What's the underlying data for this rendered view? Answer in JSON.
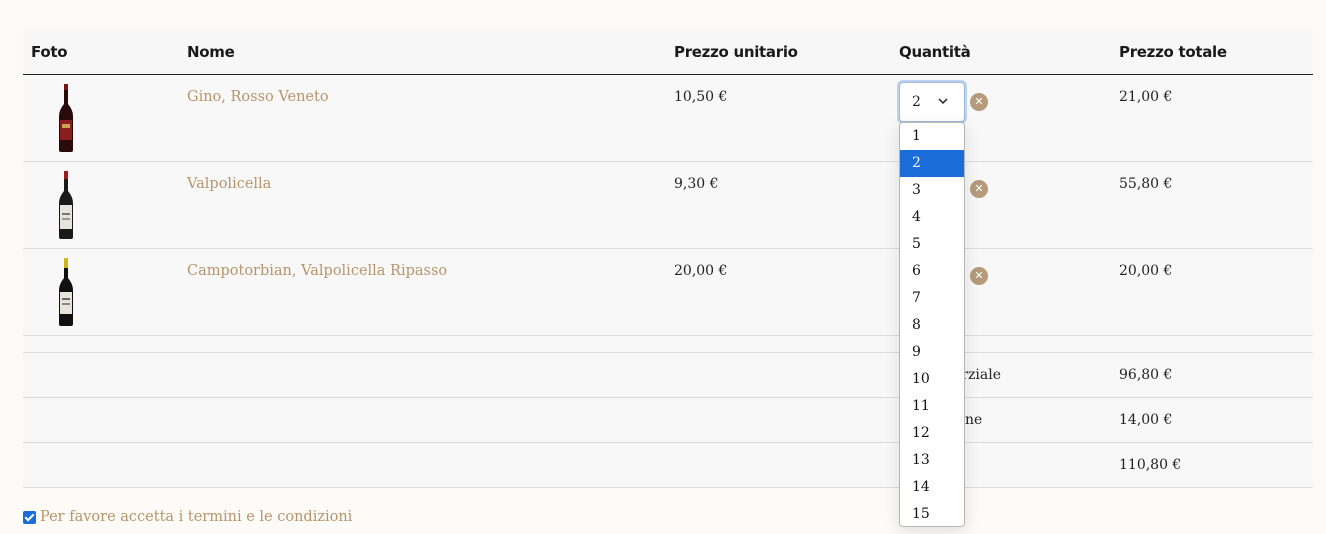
{
  "table": {
    "headers": {
      "foto": "Foto",
      "nome": "Nome",
      "prezzo_unitario": "Prezzo unitario",
      "quantita": "Quantità",
      "prezzo_totale": "Prezzo totale"
    },
    "items": [
      {
        "name": "Gino, Rosso Veneto",
        "unit_price": "10,50 €",
        "quantity": "2",
        "total": "21,00 €",
        "label_color": "#8a1d1d",
        "capsule_color": "#7a1010"
      },
      {
        "name": "Valpolicella",
        "unit_price": "9,30 €",
        "quantity": "",
        "total": "55,80 €",
        "label_color": "#e8e4dc",
        "capsule_color": "#a01818"
      },
      {
        "name": "Campotorbian, Valpolicella Ripasso",
        "unit_price": "20,00 €",
        "quantity": "",
        "total": "20,00 €",
        "label_color": "#e8e4dc",
        "capsule_color": "#d4b21a"
      }
    ],
    "summary": [
      {
        "label": "arziale",
        "value": "96,80 €"
      },
      {
        "label": "ne",
        "value": "14,00 €"
      },
      {
        "label": "",
        "value": "110,80 €"
      }
    ]
  },
  "dropdown": {
    "options": [
      "1",
      "2",
      "3",
      "4",
      "5",
      "6",
      "7",
      "8",
      "9",
      "10",
      "11",
      "12",
      "13",
      "14",
      "15"
    ],
    "selected": "2"
  },
  "terms": {
    "label": "Per favore accetta i termini e le condizioni",
    "checked": true
  },
  "colors": {
    "accent_link": "#b7946a",
    "select_blue": "#1a6cd8",
    "remove_icon": "#b59a7b"
  }
}
